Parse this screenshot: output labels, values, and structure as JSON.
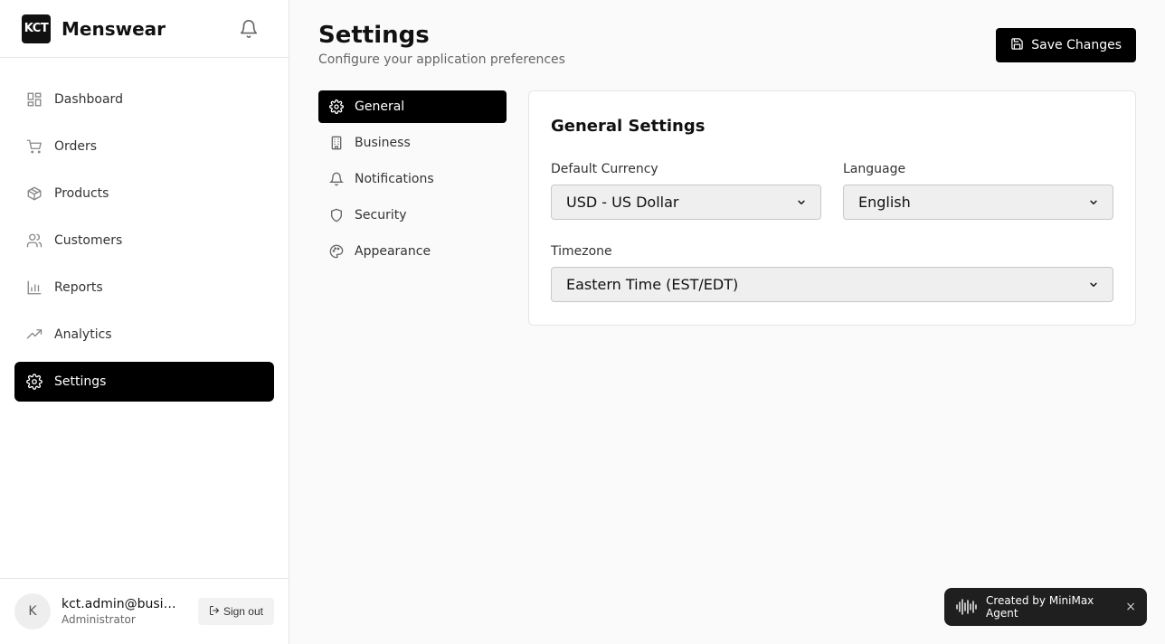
{
  "brand": {
    "logo_text": "KCT",
    "name": "Menswear"
  },
  "sidebar": {
    "items": [
      {
        "label": "Dashboard",
        "icon": "dashboard-icon"
      },
      {
        "label": "Orders",
        "icon": "cart-icon"
      },
      {
        "label": "Products",
        "icon": "box-icon"
      },
      {
        "label": "Customers",
        "icon": "users-icon"
      },
      {
        "label": "Reports",
        "icon": "bar-chart-icon"
      },
      {
        "label": "Analytics",
        "icon": "trending-icon"
      },
      {
        "label": "Settings",
        "icon": "gear-icon",
        "active": true
      }
    ]
  },
  "user": {
    "initial": "K",
    "email": "kct.admin@business.com",
    "role": "Administrator",
    "signout_label": "Sign out"
  },
  "header": {
    "title": "Settings",
    "subtitle": "Configure your application preferences",
    "save_label": "Save Changes"
  },
  "tabs": [
    {
      "label": "General",
      "icon": "gear-icon",
      "active": true
    },
    {
      "label": "Business",
      "icon": "building-icon"
    },
    {
      "label": "Notifications",
      "icon": "bell-icon"
    },
    {
      "label": "Security",
      "icon": "shield-icon"
    },
    {
      "label": "Appearance",
      "icon": "palette-icon"
    }
  ],
  "panel": {
    "title": "General Settings",
    "currency": {
      "label": "Default Currency",
      "value": "USD - US Dollar"
    },
    "language": {
      "label": "Language",
      "value": "English"
    },
    "timezone": {
      "label": "Timezone",
      "value": "Eastern Time (EST/EDT)"
    }
  },
  "toast": {
    "text": "Created by MiniMax Agent",
    "close": "×"
  },
  "colors": {
    "accent": "#000000",
    "sidebar_bg": "#ffffff",
    "page_bg": "#fafafa"
  }
}
